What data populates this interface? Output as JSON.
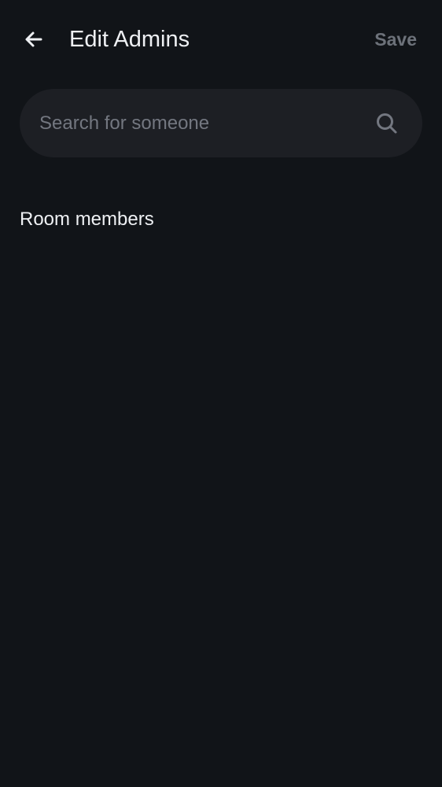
{
  "header": {
    "title": "Edit Admins",
    "save_label": "Save",
    "back_icon": "arrow-left-icon"
  },
  "search": {
    "placeholder": "Search for someone",
    "value": "",
    "icon": "search-icon"
  },
  "section": {
    "title": "Room members"
  },
  "colors": {
    "background": "#111418",
    "surface": "#1d1f24",
    "text_primary": "#eef0f3",
    "text_muted": "#737780",
    "save_disabled": "#6d727a"
  }
}
